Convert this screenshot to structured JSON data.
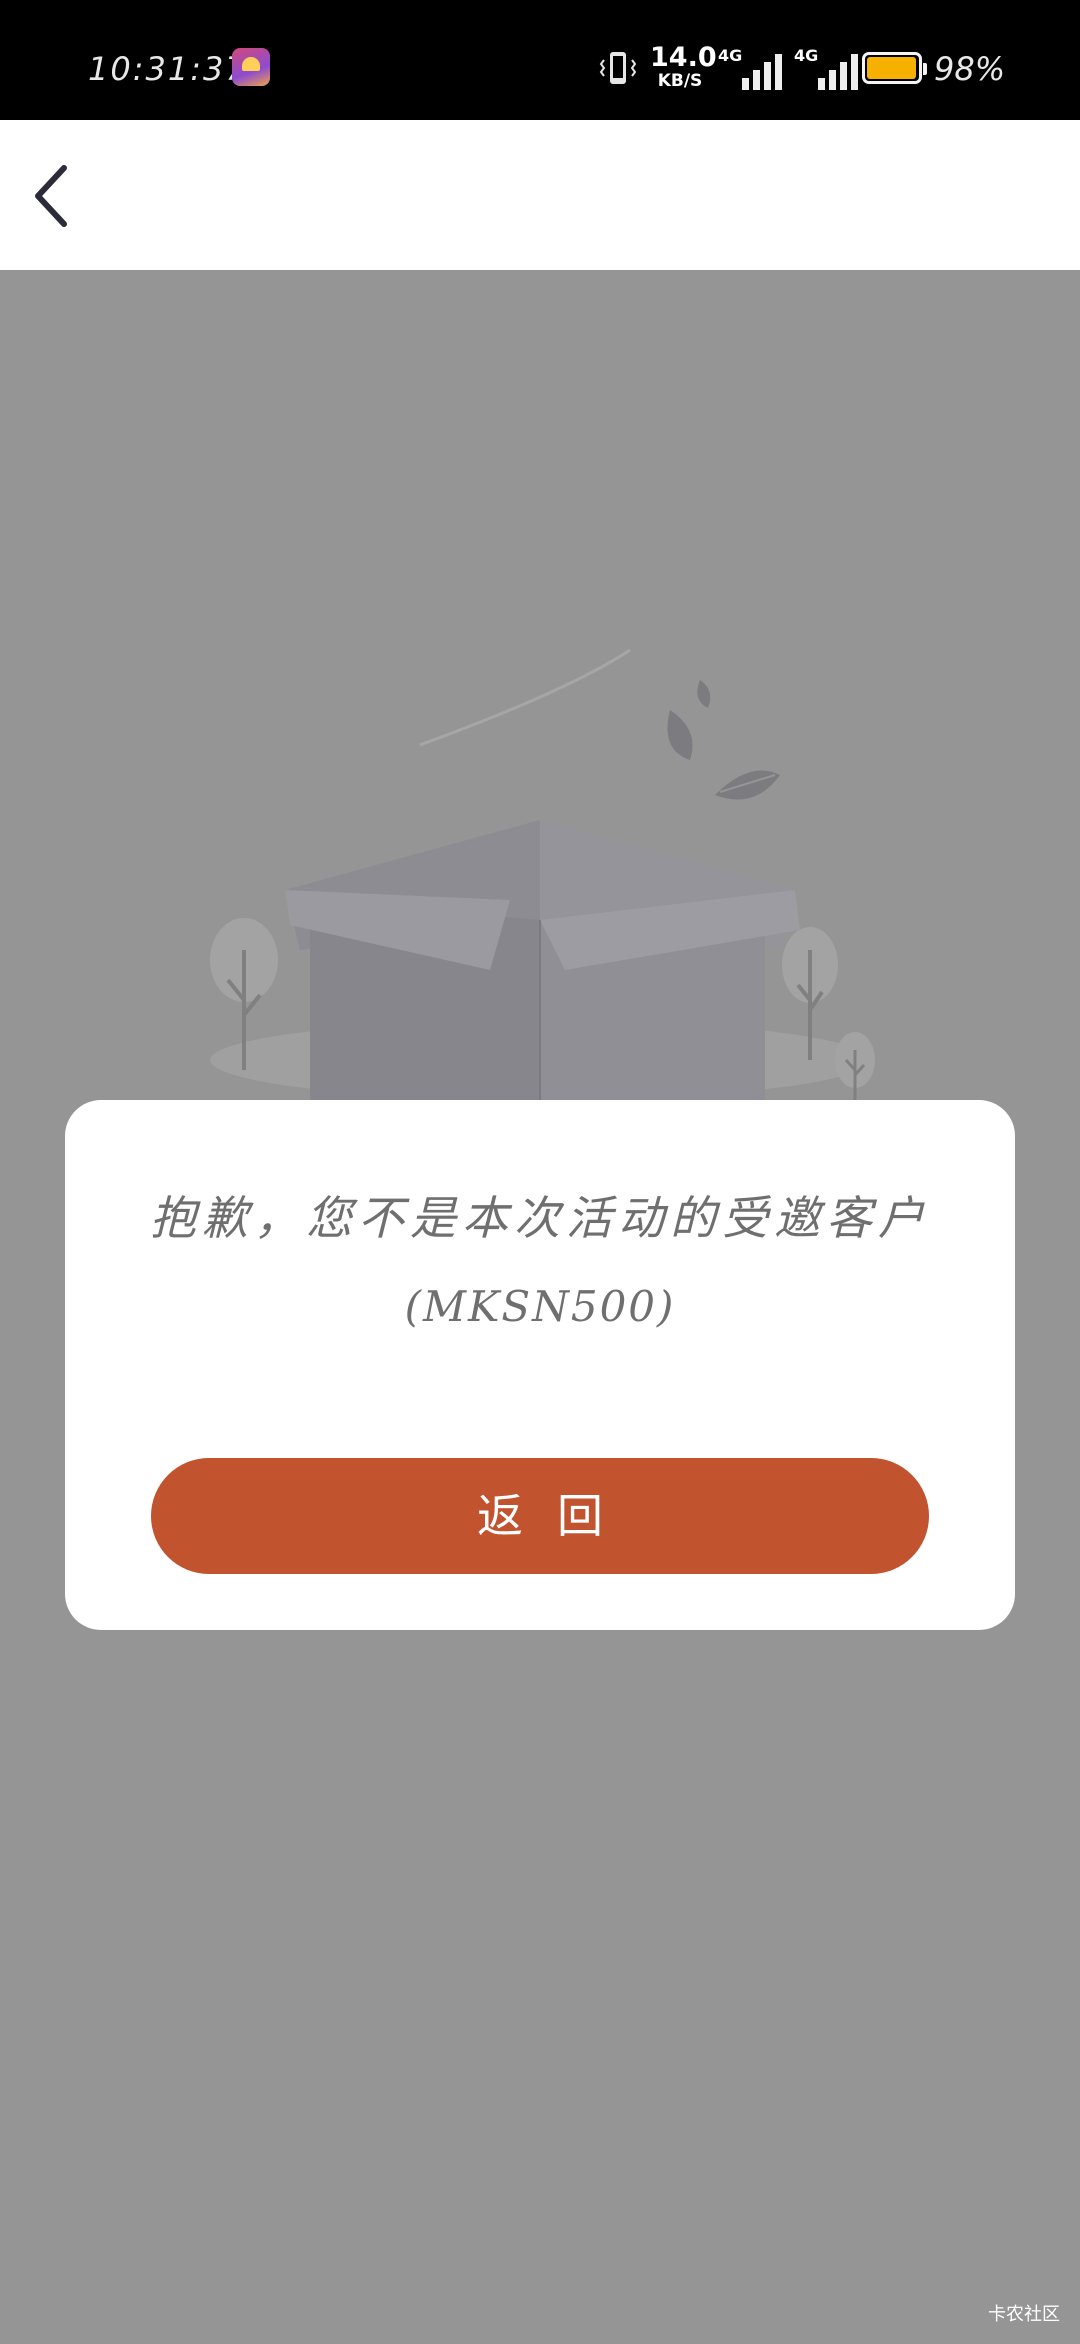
{
  "status_bar": {
    "time": "10:31:37",
    "speed_value": "14.0",
    "speed_unit": "KB/S",
    "network_1": "4G",
    "network_2": "4G",
    "battery_percent": "98%",
    "battery_level": 0.98
  },
  "dialog": {
    "message": "抱歉，您不是本次活动的受邀客户",
    "code": "(MKSN500)",
    "return_label": "返回"
  },
  "watermark": "卡农社区",
  "colors": {
    "accent": "#c2532f",
    "overlay": "#959595"
  }
}
